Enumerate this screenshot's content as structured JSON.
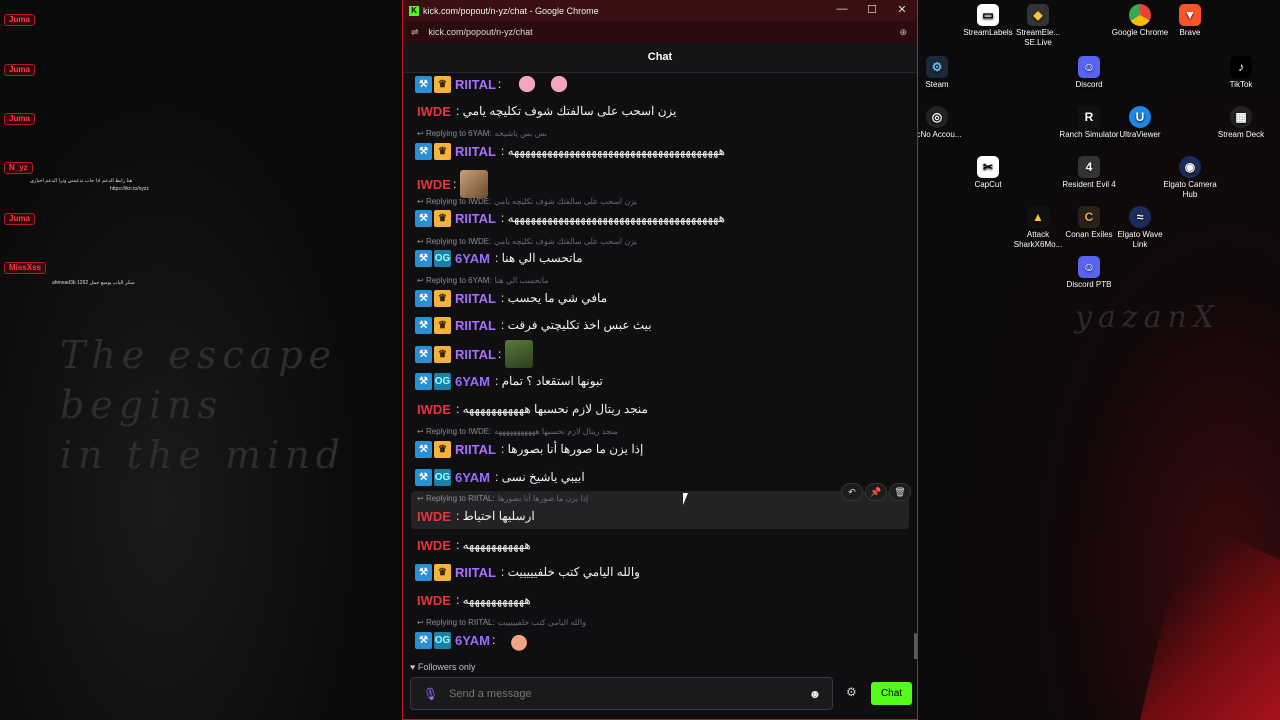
{
  "browser": {
    "window_title": "kick.com/popout/n-yz/chat - Google Chrome",
    "url": "kick.com/popout/n-yz/chat",
    "icons": {
      "favicon": "kick-logo",
      "minimize": "minimize-icon",
      "maximize": "maximize-icon",
      "close": "close-icon",
      "site_settings": "tune-icon",
      "zoom": "zoom-icon"
    }
  },
  "chat": {
    "header": "Chat",
    "messages": [
      {
        "user": "RIITAL",
        "text": ":",
        "emote": "pink-blob"
      },
      {
        "user": "IWDE",
        "text": ": يزن اسحب على سالفتك شوف تكليچه يامي"
      },
      {
        "reply_to": "Replying to 6YAM:",
        "reply_quote": "بس بس ياشيخه"
      },
      {
        "user": "RIITAL",
        "text": ": ههههههههههههههههههههههههههههههههههههههه"
      },
      {
        "user": "IWDE",
        "text": ":",
        "emote": "photo"
      },
      {
        "reply_to": "Replying to IWDE:",
        "reply_quote": "يزن اسحب على سالفتك شوف تكليچه يامي"
      },
      {
        "user": "RIITAL",
        "text": ": ههههههههههههههههههههههههههههههههههههههه"
      },
      {
        "reply_to": "Replying to IWDE:",
        "reply_quote": "يزن اسحب على سالفتك شوف تكليچه يامي"
      },
      {
        "user": "6YAM",
        "text": ": ماتحسب الي هنا"
      },
      {
        "reply_to": "Replying to 6YAM:",
        "reply_quote": "ماتحسب الي هنا"
      },
      {
        "user": "RIITAL",
        "text": ": مافي شي ما يحسب"
      },
      {
        "user": "RIITAL",
        "text": ": بيث عبس اخذ تكليچتي فرقت"
      },
      {
        "user": "RIITAL",
        "text": ":",
        "emote": "photo2"
      },
      {
        "user": "6YAM",
        "text": ": تبونها استقعاد ؟ تمام"
      },
      {
        "user": "IWDE",
        "text": ": منجد ريتال لازم نحسبها هههههههههههه"
      },
      {
        "reply_to": "Replying to IWDE:",
        "reply_quote": "منجد ريتال لازم نحسبها هههههههههههه"
      },
      {
        "user": "RIITAL",
        "text": ": إذا يزن ما صورها أنا بصورها"
      },
      {
        "user": "6YAM",
        "text": ": ابيبي ياشيخ نسى"
      },
      {
        "reply_to": "Replying to RIITAL:",
        "reply_quote": "إذا يزن ما صورها أنا بصورها"
      },
      {
        "user": "IWDE",
        "text": ": ارسليها احتياط"
      },
      {
        "user": "IWDE",
        "text": ": هههههههههههه"
      },
      {
        "user": "RIITAL",
        "text": ": والله اليامي كتب خلفيييييت"
      },
      {
        "user": "IWDE",
        "text": ": هههههههههههه"
      },
      {
        "reply_to": "Replying to RIITAL:",
        "reply_quote": "والله اليامي كتب خلفيييييت"
      },
      {
        "user": "6YAM",
        "text": ":",
        "emote": "peach-hand"
      }
    ],
    "hover_actions": {
      "reply": "reply-icon",
      "pin": "pin-icon",
      "delete": "trash-icon"
    },
    "followers_only": "Followers only",
    "input_placeholder": "Send a message",
    "chat_button": "Chat",
    "colors": {
      "accent": "#53fc18",
      "riital": "#a970ff",
      "iwde": "#e8323e",
      "6yam": "#9c6bff"
    }
  },
  "desktop": {
    "icons": [
      {
        "label": "StreamLabels",
        "icon": "streamlabels-icon"
      },
      {
        "label": "StreamEle... SE.Live",
        "icon": "streamelements-icon"
      },
      {
        "label": "Google Chrome",
        "icon": "chrome-icon"
      },
      {
        "label": "Brave",
        "icon": "brave-icon"
      },
      {
        "label": "Steam",
        "icon": "steam-icon"
      },
      {
        "label": "Discord",
        "icon": "discord-icon"
      },
      {
        "label": "TikTok",
        "icon": "tiktok-icon"
      },
      {
        "label": "TcNo Accou...",
        "icon": "tcno-icon"
      },
      {
        "label": "Ranch Simulator",
        "icon": "ranch-icon"
      },
      {
        "label": "UltraViewer",
        "icon": "ultraviewer-icon"
      },
      {
        "label": "Stream Deck",
        "icon": "streamdeck-icon"
      },
      {
        "label": "CapCut",
        "icon": "capcut-icon"
      },
      {
        "label": "Resident Evil 4",
        "icon": "re4-icon"
      },
      {
        "label": "Elgato Camera Hub",
        "icon": "elgato-camera-icon"
      },
      {
        "label": "Attack SharkX6Mo...",
        "icon": "attackshark-icon"
      },
      {
        "label": "Conan Exiles",
        "icon": "conan-icon"
      },
      {
        "label": "Elgato Wave Link",
        "icon": "elgato-wave-icon"
      },
      {
        "label": "Discord PTB",
        "icon": "discord-ptb-icon"
      }
    ],
    "overlay_alerts": [
      "Juma",
      "Juma",
      "Juma",
      "N_yz",
      "Juma",
      "MissXss"
    ],
    "overlay_note": "هنا رابط الدعم اذا حاب تدعمني وترا الدعم اجباري",
    "overlay_link": "https://tkn.to/nyzz",
    "overlay_bottom": "ahmead3b سكر الباب يوسع جمل 1262",
    "tagline_lines": [
      "The escape",
      "begins",
      "in the mind"
    ],
    "watermark": "yazanX"
  }
}
